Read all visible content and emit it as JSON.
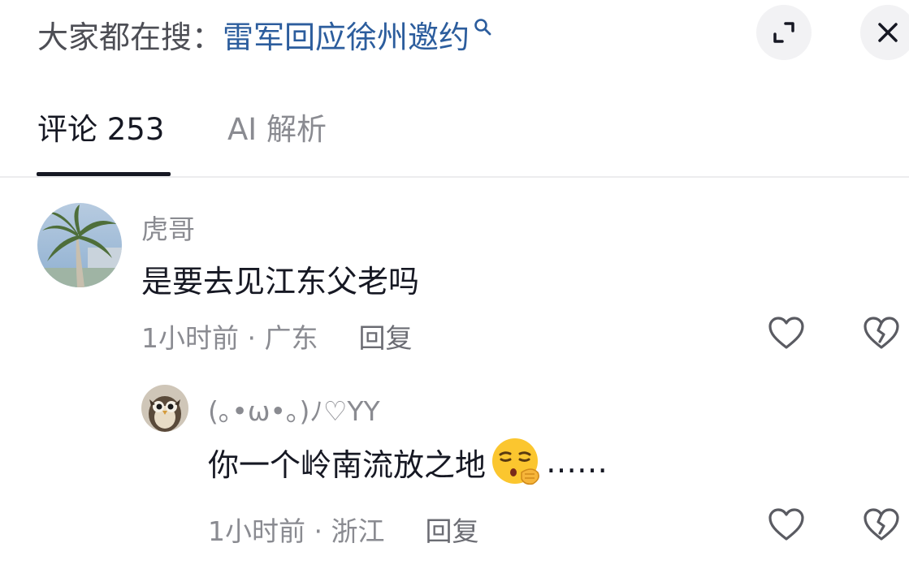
{
  "header": {
    "search_prefix": "大家都在搜：",
    "search_query": "雷军回应徐州邀约",
    "icons": {
      "search": "search-icon",
      "expand": "expand-icon",
      "close": "close-icon"
    }
  },
  "tabs": [
    {
      "label": "评论 253",
      "active": true
    },
    {
      "label": "AI 解析",
      "active": false
    }
  ],
  "comments": [
    {
      "username": "虎哥",
      "text": "是要去见江东父老吗",
      "meta": "1小时前 · 广东",
      "reply_label": "回复",
      "avatar": "palm-tree-avatar",
      "replies": [
        {
          "username": "(｡•ω•｡)ﾉ♡YY",
          "text": "你一个岭南流放之地",
          "emoji": "hushed-emoji",
          "text_suffix": "……",
          "meta": "1小时前 · 浙江",
          "reply_label": "回复",
          "avatar": "owl-avatar"
        }
      ]
    }
  ],
  "colors": {
    "link": "#2c5d9d",
    "text": "#161823",
    "muted": "#8a8b91",
    "button_bg": "#f2f2f4"
  }
}
